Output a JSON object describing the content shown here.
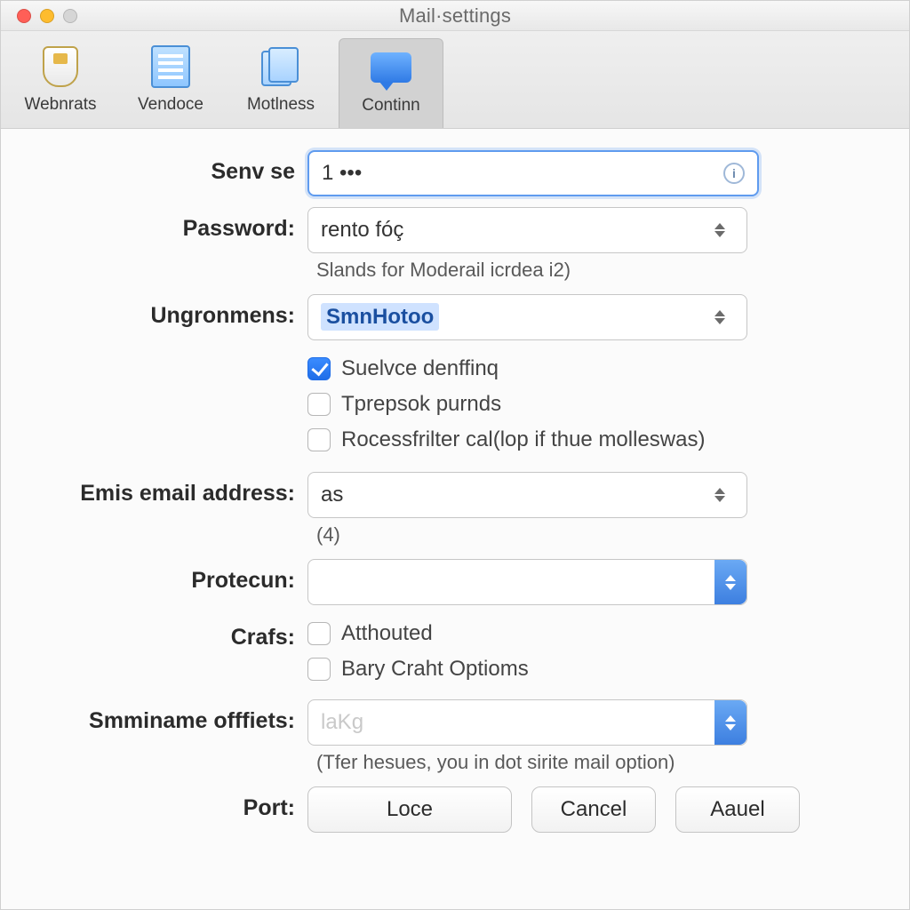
{
  "window_title": "Mail·settings",
  "tabs": [
    {
      "label": "Webnrats"
    },
    {
      "label": "Vendoce"
    },
    {
      "label": "Motlness"
    },
    {
      "label": "Continn",
      "selected": true
    }
  ],
  "form": {
    "senv_label": "Senv se",
    "senv_value": "1 •••",
    "password_label": "Password:",
    "password_value": "rento fóç",
    "password_hint": "Slands for Moderail icrdea i2)",
    "ungron_label": "Ungronmens:",
    "ungron_value": "SmnHotoo",
    "chk_suelvce": "Suelvce denffinq",
    "chk_tprepsok": "Tprepsok purnds",
    "chk_rocess": "Rocessfrilter cal(lop if thue molleswas)",
    "email_label": "Emis email address:",
    "email_value": "as",
    "email_hint": "(4)",
    "protecun_label": "Protecun:",
    "protecun_value": "",
    "crafs_label": "Crafs:",
    "chk_atthouted": "Atthouted",
    "chk_bary": "Bary Craht Optioms",
    "smmin_label": "Smminame offfiets:",
    "smmin_placeholder": "laKg",
    "smmin_hint": "(Tfer  hesues, you in dot sirite mail option)",
    "port_label": "Port:",
    "buttons": {
      "loce": "Loce",
      "cancel": "Cancel",
      "aauel": "Aauel"
    }
  }
}
